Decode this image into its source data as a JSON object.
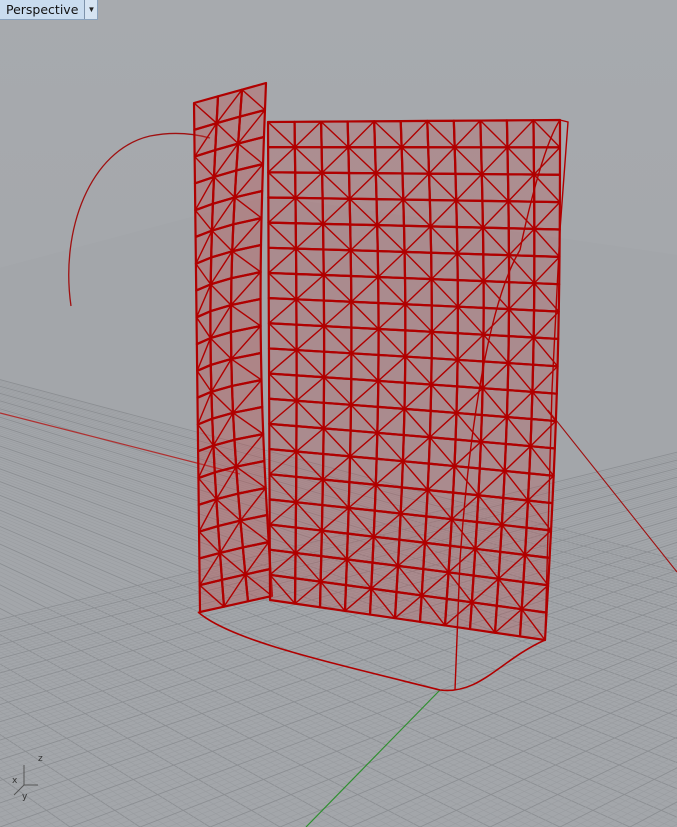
{
  "viewport": {
    "title": "Perspective",
    "dropdown_icon": "triangle-down-icon",
    "axis_labels": {
      "x": "x",
      "y": "y",
      "z": "z"
    },
    "colors": {
      "background": "#a7aaae",
      "grid_minor": "#9a9da1",
      "grid_major": "#8c8f93",
      "x_axis": "#b03030",
      "y_axis": "#2f8f2f",
      "model_edge": "#b00000",
      "model_fill": "#c04848",
      "tab_background": "#c9dcef"
    }
  }
}
